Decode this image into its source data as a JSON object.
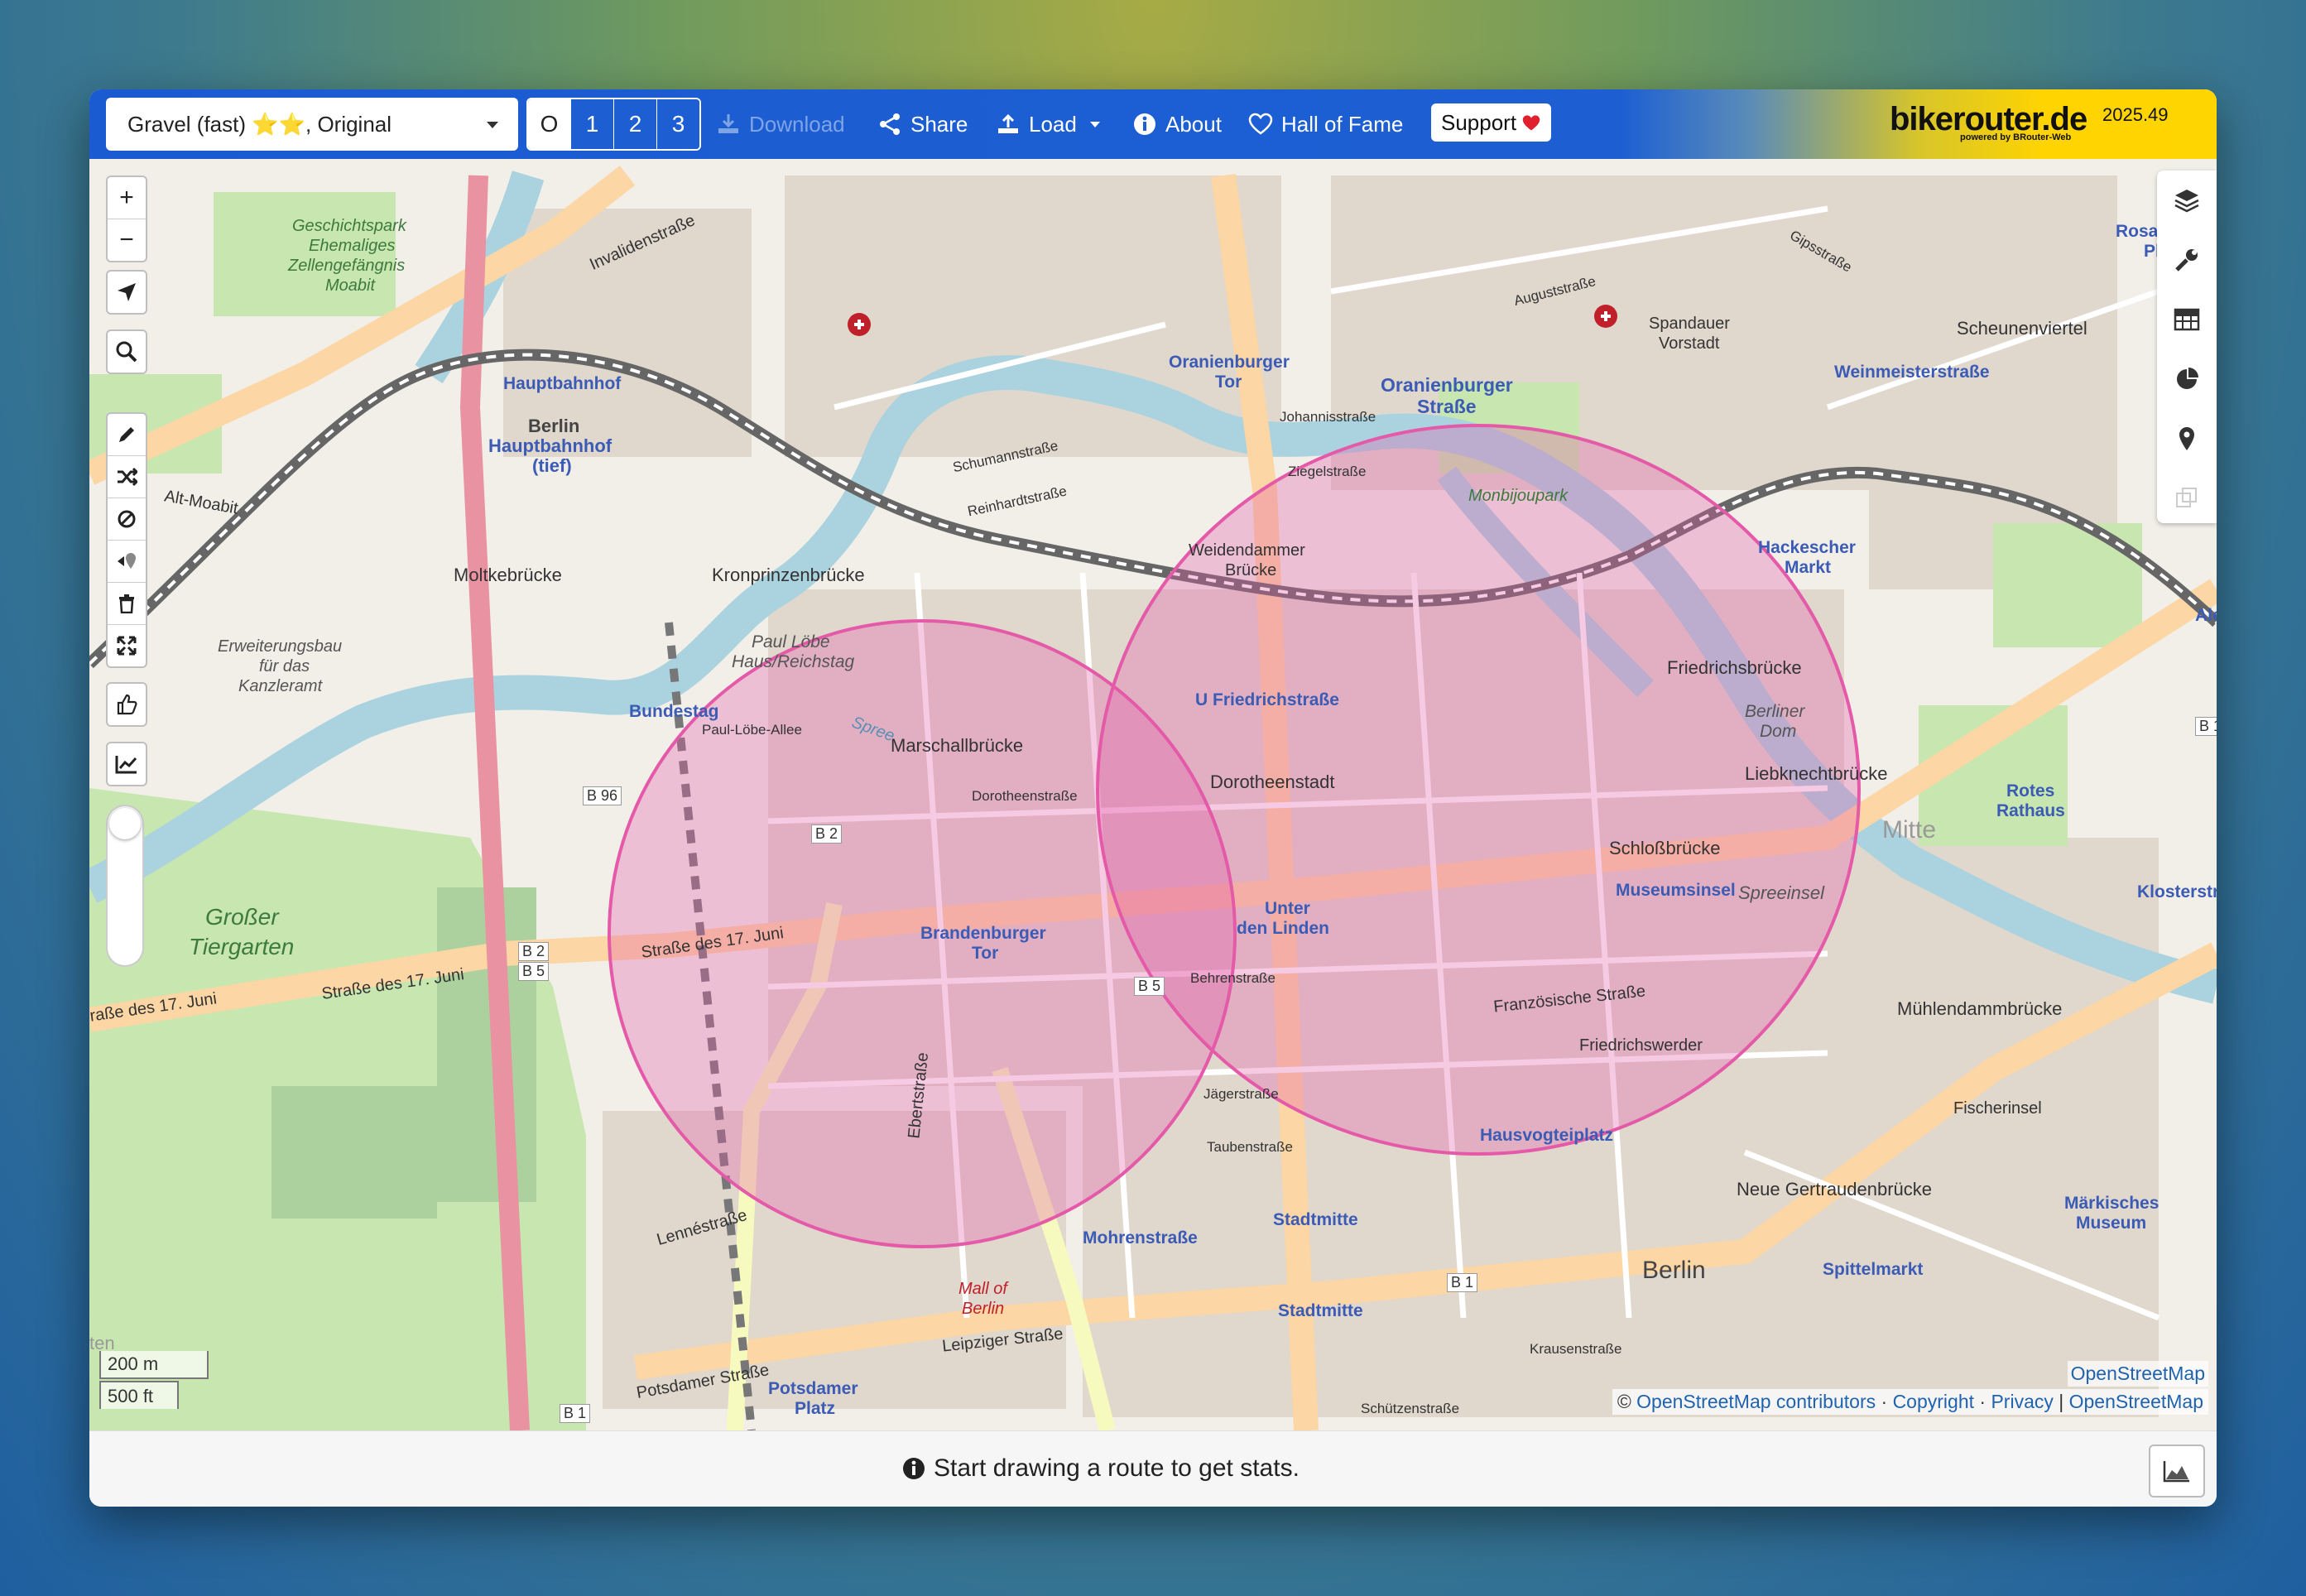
{
  "toolbar": {
    "profile": "Gravel (fast) ⭐⭐, Original",
    "alternatives": [
      "O",
      "1",
      "2",
      "3"
    ],
    "download": "Download",
    "share": "Share",
    "load": "Load",
    "about": "About",
    "hall_of_fame": "Hall of Fame",
    "support": "Support",
    "brand": "bikerouter.de",
    "brand_sub": "powered by BRouter-Web",
    "version": "2025.49"
  },
  "map": {
    "labels": {
      "geschichtspark": "Geschichtspark",
      "ehemaliges": "Ehemaliges",
      "zellengefaengnis": "Zellengefängnis",
      "moabit": "Moabit",
      "invalidenstrasse": "Invalidenstraße",
      "hauptbahnhof": "Hauptbahnhof",
      "berlin_hbf": "Berlin",
      "hbf_line2": "Hauptbahnhof",
      "tief": "(tief)",
      "alt_moabit": "Alt-Moabit",
      "moltkebruecke": "Moltkebrücke",
      "kronprinzenbruecke": "Kronprinzenbrücke",
      "erweiterungsbau": "Erweiterungsbau",
      "fuer_das": "für das",
      "kanzleramt": "Kanzleramt",
      "paul_loebe_haus": "Paul Löbe",
      "haus_reichstag": "Haus/Reichstag",
      "bundestag": "Bundestag",
      "paul_loebe_allee": "Paul-Löbe-Allee",
      "marschallbruecke": "Marschallbrücke",
      "dorotheenstrasse": "Dorotheenstraße",
      "grosser": "Großer",
      "tiergarten": "Tiergarten",
      "strasse_17_juni": "Straße des 17. Juni",
      "strasse_17_juni_b": "Straße des 17. Juni",
      "strasse_17_juni_c": "raße des 17. Juni",
      "brandenburger": "Brandenburger",
      "tor": "Tor",
      "oranienburger_tor": "Oranienburger",
      "oranienburger_tor_2": "Tor",
      "oranienburger_strasse": "Oranienburger",
      "oranienburger_strasse_2": "Straße",
      "weidendammer": "Weidendammer",
      "bruecke": "Brücke",
      "friedrichstrasse": "U Friedrichstraße",
      "dorotheenstadt": "Dorotheenstadt",
      "unter": "Unter",
      "den_linden": "den Linden",
      "behrenstrasse": "Behrenstraße",
      "franzoesische": "Französische Straße",
      "schlossbruecke": "Schloßbrücke",
      "museumsinsel": "Museumsinsel",
      "spreeinsel": "Spreeinsel",
      "friedrichsbruecke": "Friedrichsbrücke",
      "liebknechtbruecke": "Liebknechtbrücke",
      "berliner_dom": "Berliner",
      "dom": "Dom",
      "hackescher": "Hackescher",
      "markt": "Markt",
      "monbijoupark": "Monbijoupark",
      "spandauer": "Spandauer",
      "vorstadt": "Vorstadt",
      "weinmeisterstrasse": "Weinmeisterstraße",
      "rosa_luxemburg": "Rosa-Luxemb",
      "platz": "Platz",
      "scheunenviertel": "Scheunenviertel",
      "mitte": "Mitte",
      "rotes": "Rotes",
      "rathaus": "Rathaus",
      "klosterstr": "Klosterstr",
      "muehlendammbruecke": "Mühlendammbrücke",
      "fischerinsel": "Fischerinsel",
      "friedrichswerder": "Friedrichswerder",
      "hausvogteiplatz": "Hausvogteiplatz",
      "neue_gertraudenbruecke": "Neue Gertraudenbrücke",
      "berlin": "Berlin",
      "spittelmarkt": "Spittelmarkt",
      "maerkisches": "Märkisches",
      "museum": "Museum",
      "stadtmitte": "Stadtmitte",
      "stadtmitte_2": "Stadtmitte",
      "mohrenstrasse": "Mohrenstraße",
      "leipziger_strasse": "Leipziger Straße",
      "potsdamer_strasse": "Potsdamer Straße",
      "potsdamer": "Potsdamer",
      "platz_2": "Platz",
      "lennestrasse": "Lennéstraße",
      "ebertstrasse": "Ebertstraße",
      "mall_of": "Mall of",
      "berlin_mall": "Berlin",
      "jaegerstrasse": "Jägerstraße",
      "taubenstrasse": "Taubenstraße",
      "krausenstrasse": "Krausenstraße",
      "schuetzenstrasse": "Schützenstraße",
      "johannisstrasse": "Johannisstraße",
      "ziegelstrasse": "Ziegelstraße",
      "reinhardtstrasse": "Reinhardtstraße",
      "schumannstrasse": "Schumannstraße",
      "augustrasse": "Auguststraße",
      "gipsstrasse": "Gipsstraße",
      "b96": "B 96",
      "b2": "B 2",
      "b2b5": "B 2",
      "b5_side": "B 5",
      "b5": "B 5",
      "b1": "B 1",
      "b1b": "B 1",
      "b1c": "B 1",
      "spree": "Spree",
      "ale": "Ale",
      "ten": "ten"
    }
  },
  "scale": {
    "meters": "200 m",
    "feet": "500 ft"
  },
  "attribution": {
    "top": "OpenStreetMap",
    "prefix": "©",
    "contributors": "OpenStreetMap contributors",
    "sep1": "·",
    "copyright": "Copyright",
    "sep2": "·",
    "privacy": "Privacy",
    "sep3": "|",
    "osm": "OpenStreetMap"
  },
  "footer": {
    "message": "Start drawing a route to get stats."
  },
  "colors": {
    "toolbar_blue": "#1d5fd3",
    "brand_yellow": "#ffd500",
    "nogo_circle": "#e45aa8",
    "water": "#aad3df",
    "park": "#c8e6b0",
    "road_major": "#fcd6a4"
  }
}
